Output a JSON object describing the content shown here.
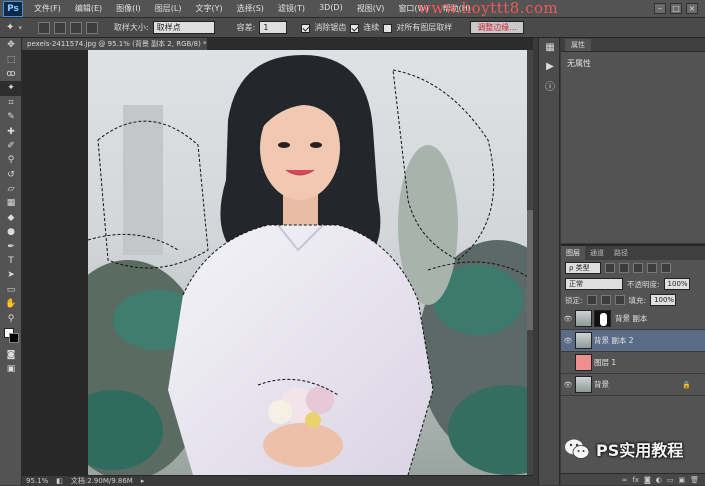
{
  "app": {
    "logo": "Ps"
  },
  "menu": [
    "文件(F)",
    "编辑(E)",
    "图像(I)",
    "图层(L)",
    "文字(Y)",
    "选择(S)",
    "滤镜(T)",
    "3D(D)",
    "视图(V)",
    "窗口(W)",
    "帮助(H)"
  ],
  "watermark": "www.hoyttt8.com",
  "window_buttons": [
    "–",
    "□",
    "×"
  ],
  "options": {
    "sample_size_label": "取样大小:",
    "sample_size_value": "取样点",
    "tolerance_label": "容差:",
    "tolerance_value": "1",
    "antialias_label": "消除锯齿",
    "contiguous_label": "连续",
    "sample_all_label": "对所有图层取样",
    "refine_edge_label": "调整边缘..."
  },
  "document": {
    "tab_label": "pexels-2411574.jpg @ 95.1% (背景 副本 2, RGB/8) *",
    "zoom": "95.1%",
    "doc_size": "文档:2.90M/9.86M"
  },
  "properties": {
    "tab": "属性",
    "empty_text": "无属性"
  },
  "layers": {
    "tabs": [
      "图层",
      "通道",
      "路径"
    ],
    "filter_kind": "ρ 类型",
    "blend_mode": "正常",
    "opacity_label": "不透明度:",
    "opacity_value": "100%",
    "lock_label": "锁定:",
    "fill_label": "填充:",
    "fill_value": "100%",
    "items": [
      {
        "name": "背景 副本",
        "visible": true,
        "has_mask": true,
        "thumb": "photo",
        "selected": false
      },
      {
        "name": "背景 副本 2",
        "visible": true,
        "has_mask": false,
        "thumb": "photo",
        "selected": true
      },
      {
        "name": "图层 1",
        "visible": false,
        "has_mask": false,
        "thumb": "#ef8e8e",
        "selected": false
      },
      {
        "name": "背景",
        "visible": true,
        "has_mask": false,
        "thumb": "photo",
        "selected": false,
        "locked": true
      }
    ]
  },
  "wechat_watermark": "PS实用教程",
  "colors": {
    "accent_selected_layer": "#596b85",
    "watermark_red": "#ff5a5a",
    "layer1_fill": "#ef8e8e"
  }
}
